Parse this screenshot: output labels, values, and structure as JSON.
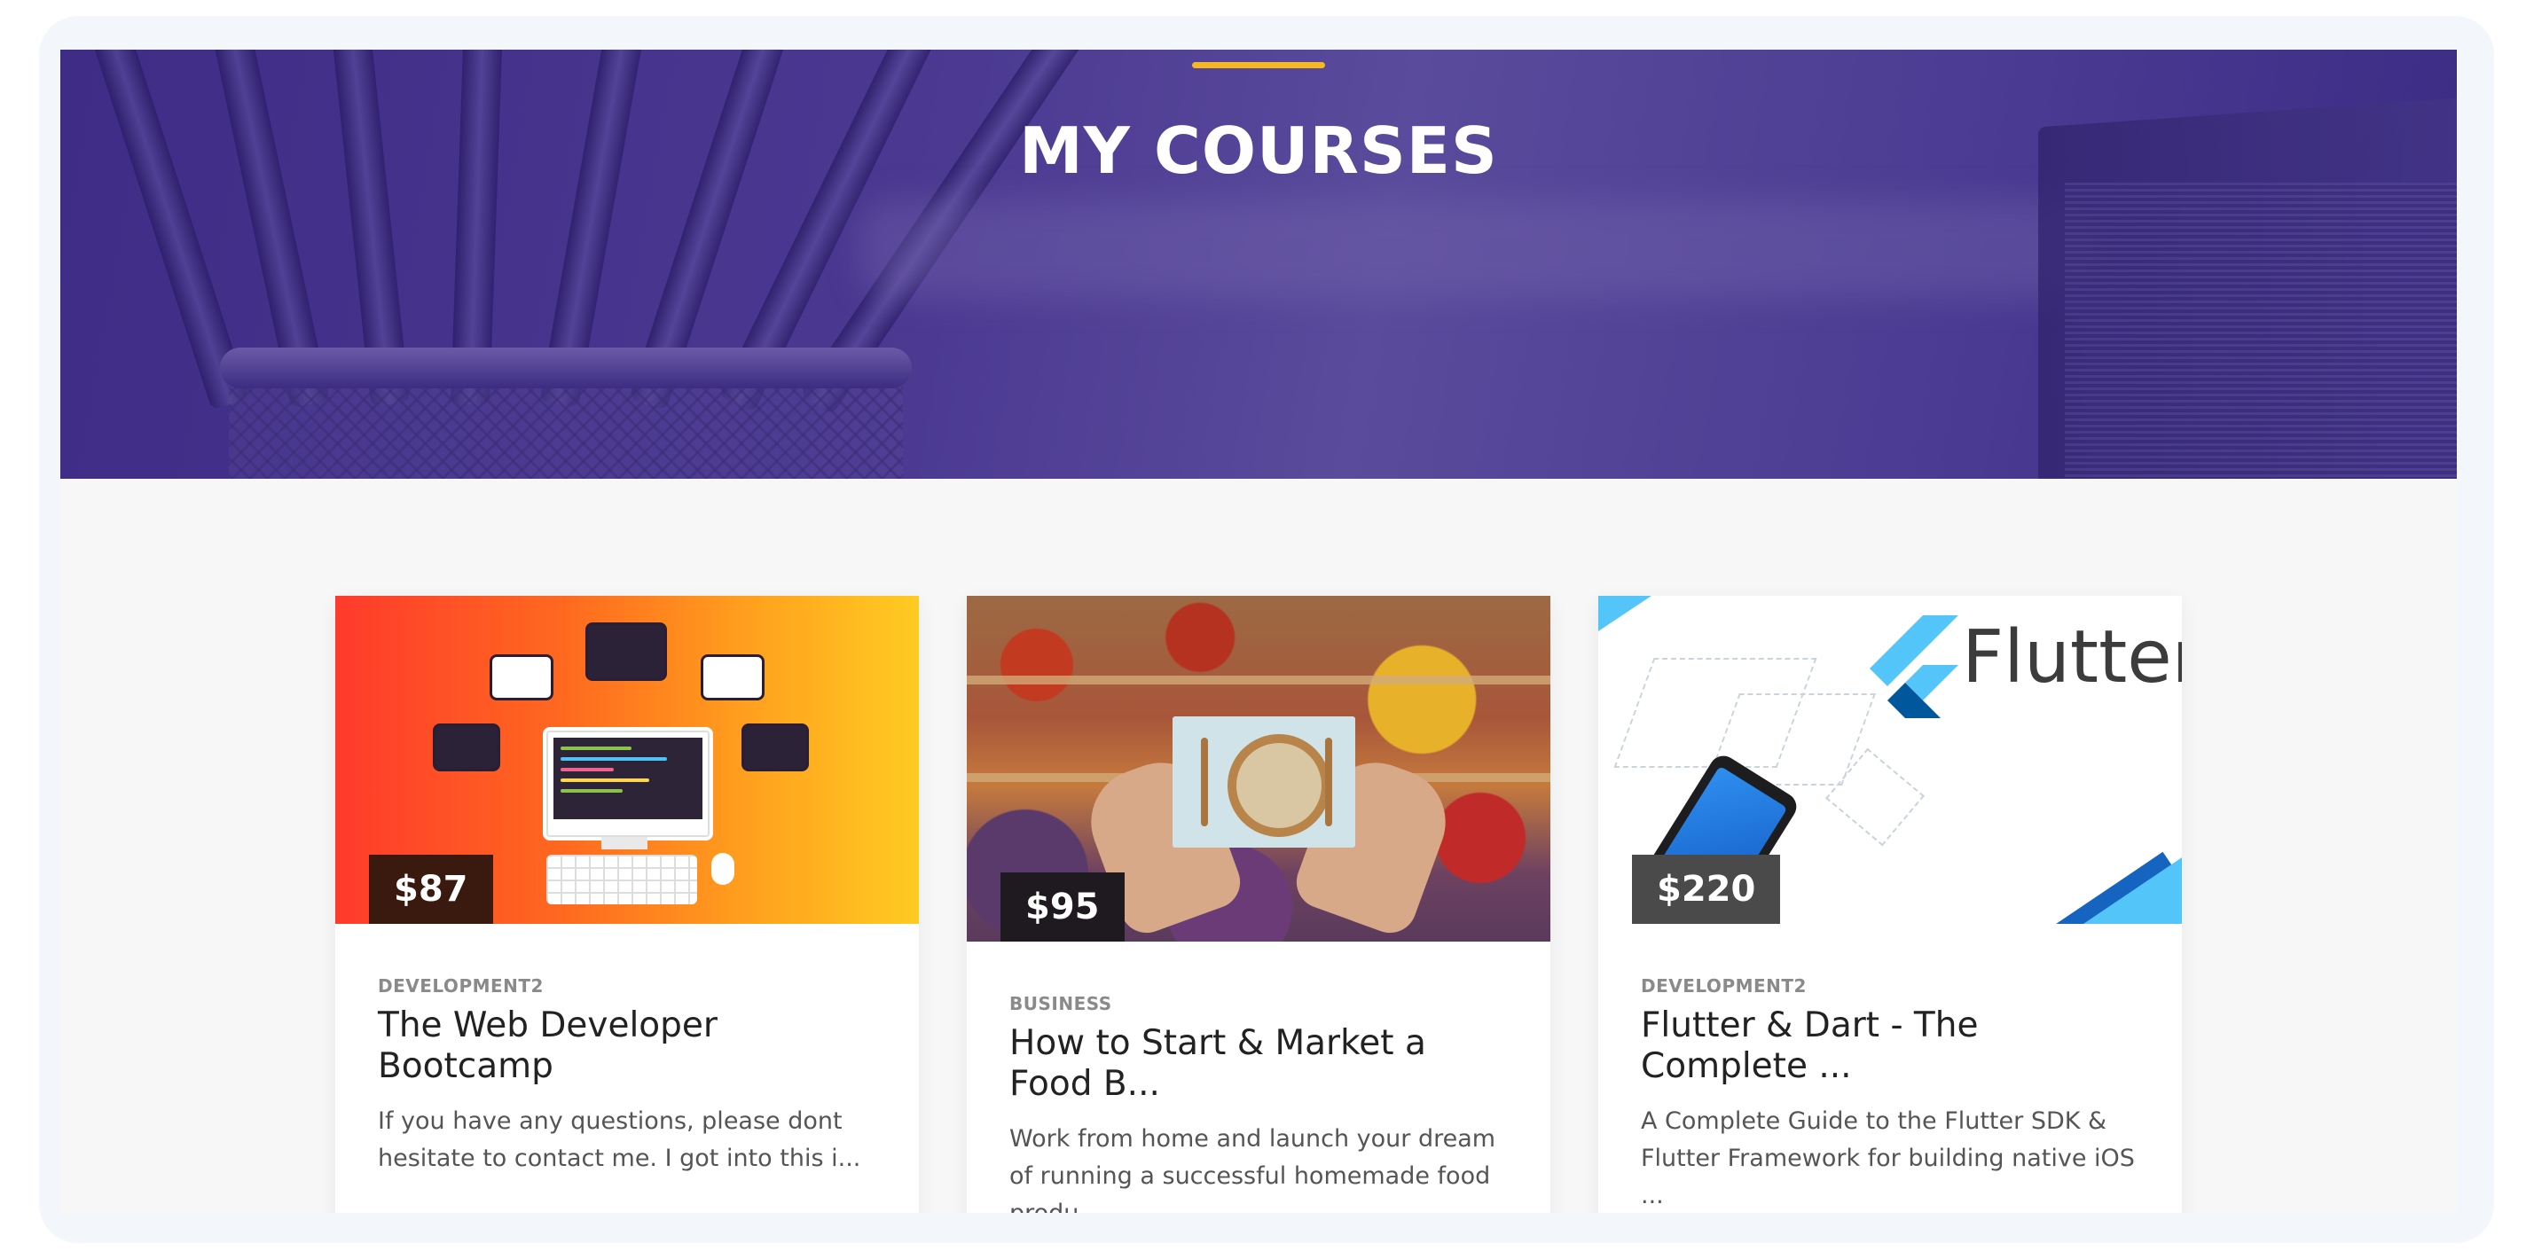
{
  "hero": {
    "title": "MY COURSES",
    "accent_color": "#f5b821",
    "overlay_color": "#4a3891"
  },
  "courses": [
    {
      "price": "$87",
      "price_bg": "#3a1a0f",
      "category": "DEVELOPMENT2",
      "title": "The Web Developer Bootcamp",
      "description": "If you have any questions, please dont hesitate to contact me. I got into this i...",
      "thumbnail": "web-developer-illustration"
    },
    {
      "price": "$95",
      "price_bg": "#1e1a1f",
      "category": "BUSINESS",
      "title": "How to Start & Market a Food B...",
      "description": "Work from home and launch your dream of running a successful homemade food produ...",
      "thumbnail": "food-market-photo"
    },
    {
      "price": "$220",
      "price_bg": "#4a4a4a",
      "category": "DEVELOPMENT2",
      "title": "Flutter & Dart - The Complete ...",
      "description": "A Complete Guide to the Flutter SDK & Flutter Framework for building native iOS ...",
      "thumbnail": "flutter-banner",
      "thumbnail_text": "Flutter"
    }
  ]
}
